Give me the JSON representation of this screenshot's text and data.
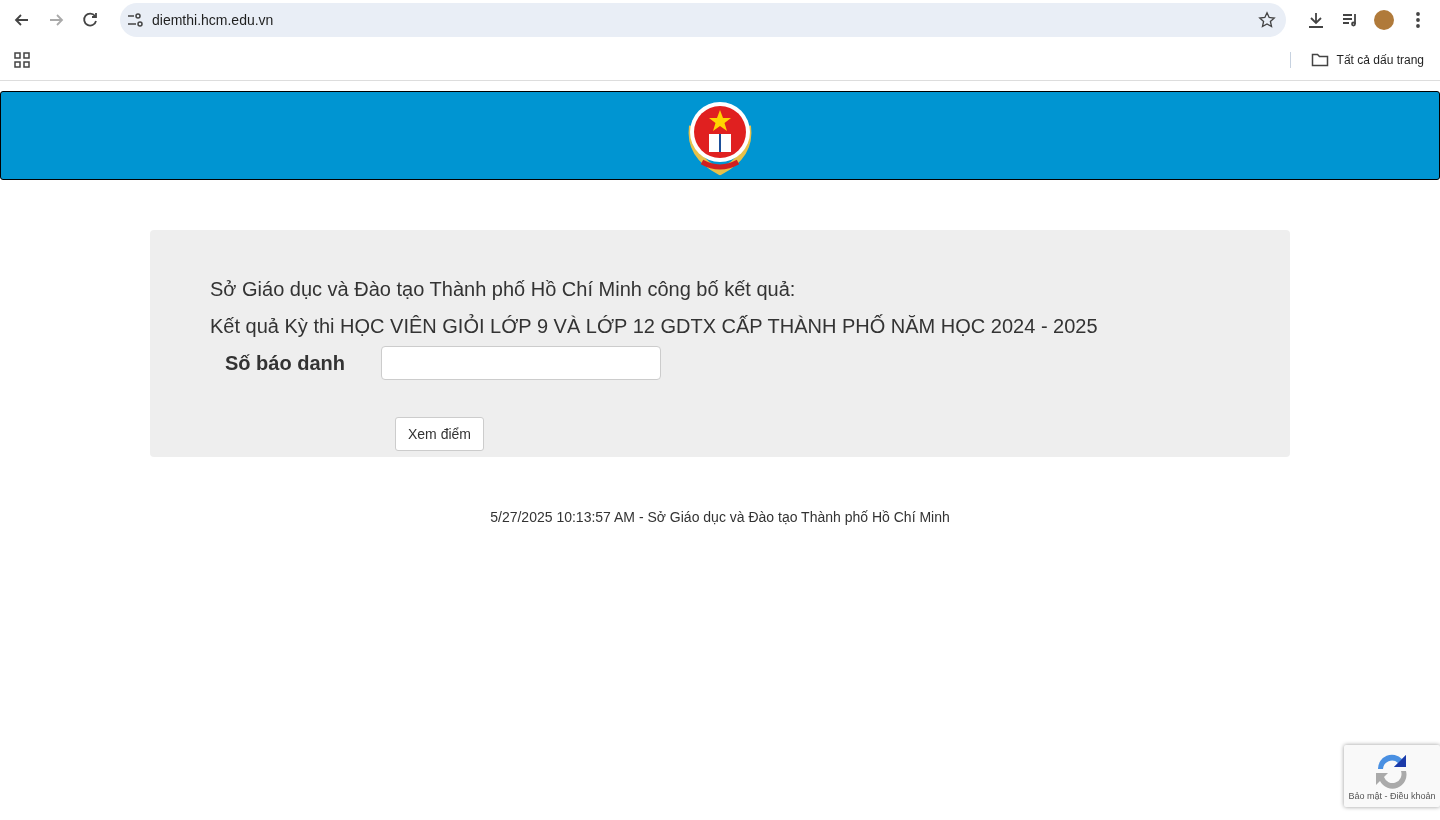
{
  "browser": {
    "url": "diemthi.hcm.edu.vn",
    "bookmarks_folder": "Tất cả dấu trang"
  },
  "form": {
    "heading": "Sở Giáo dục và Đào tạo Thành phố Hồ Chí Minh công bố kết quả:",
    "exam_title": "Kết quả Kỳ thi HỌC VIÊN GIỎI LỚP 9 VÀ LỚP 12 GDTX CẤP THÀNH PHỐ NĂM HỌC 2024 - 2025",
    "field_label": "Số báo danh",
    "submit": "Xem điểm"
  },
  "footer": "5/27/2025 10:13:57 AM - Sở Giáo dục và Đào tạo Thành phố Hồ Chí Minh",
  "captcha": {
    "links": "Bảo mật - Điều khoản"
  }
}
